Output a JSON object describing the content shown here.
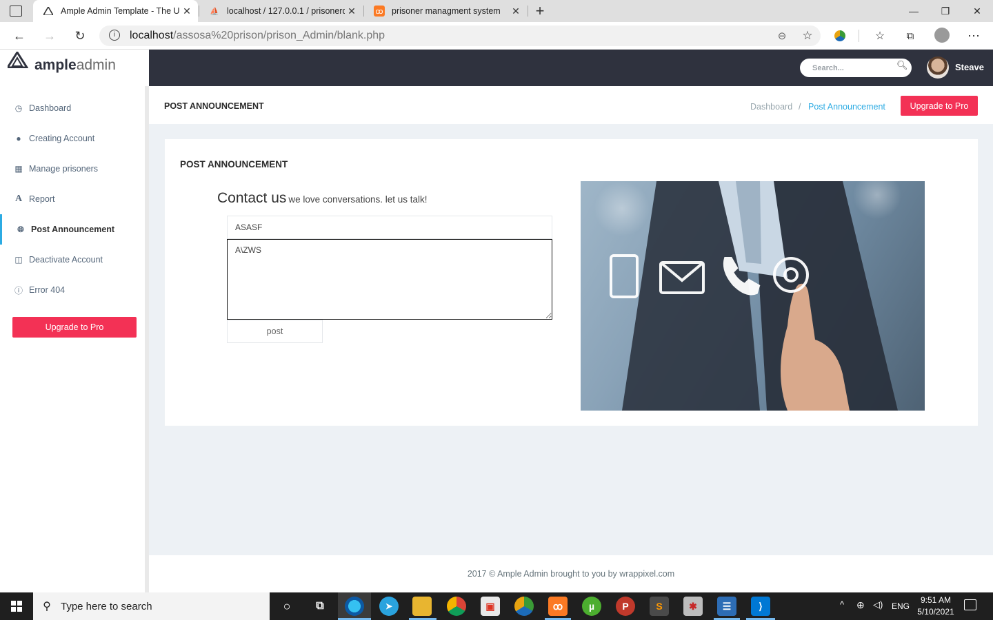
{
  "browser": {
    "tabs": [
      {
        "title": "Ample Admin Template - The Ult",
        "active": true
      },
      {
        "title": "localhost / 127.0.0.1 / prisonerdb",
        "active": false
      },
      {
        "title": "prisoner managment system",
        "active": false
      }
    ],
    "new_tab_icon": "plus-icon",
    "url_host": "localhost",
    "url_path": "/assosa%20prison/prison_Admin/blank.php"
  },
  "app": {
    "logo_bold": "ample",
    "logo_light": "admin",
    "search_placeholder": "Search...",
    "username": "Steave",
    "sidebar": {
      "items": [
        {
          "label": "Dashboard",
          "icon": "clock-icon",
          "active": false
        },
        {
          "label": "Creating Account",
          "icon": "user-icon",
          "active": false
        },
        {
          "label": "Manage prisoners",
          "icon": "table-icon",
          "active": false
        },
        {
          "label": "Report",
          "icon": "font-icon",
          "active": false
        },
        {
          "label": "Post Announcement",
          "icon": "globe-icon",
          "active": true
        },
        {
          "label": "Deactivate Account",
          "icon": "columns-icon",
          "active": false
        },
        {
          "label": "Error 404",
          "icon": "info-icon",
          "active": false
        }
      ],
      "upgrade_label": "Upgrade to Pro"
    },
    "page_title": "POST ANNOUNCEMENT",
    "breadcrumb": [
      "Dashboard",
      "Post Announcement"
    ],
    "breadcrumb_sep": "/",
    "upgrade_label": "Upgrade to Pro",
    "card": {
      "title": "POST ANNOUNCEMENT",
      "contact_heading": "Contact us",
      "contact_sub": "we love conversations. let us talk!",
      "subject_value": "ASASF",
      "message_value": "A\\ZWS",
      "post_label": "post"
    },
    "footer": "2017 © Ample Admin brought to you by wrappixel.com"
  },
  "taskbar": {
    "search_placeholder": "Type here to search",
    "language": "ENG",
    "time": "9:51 AM",
    "date": "5/10/2021"
  },
  "colors": {
    "accent": "#2cabe3",
    "danger": "#f33155",
    "topbar": "#2f323e",
    "content_bg": "#edf1f5"
  }
}
